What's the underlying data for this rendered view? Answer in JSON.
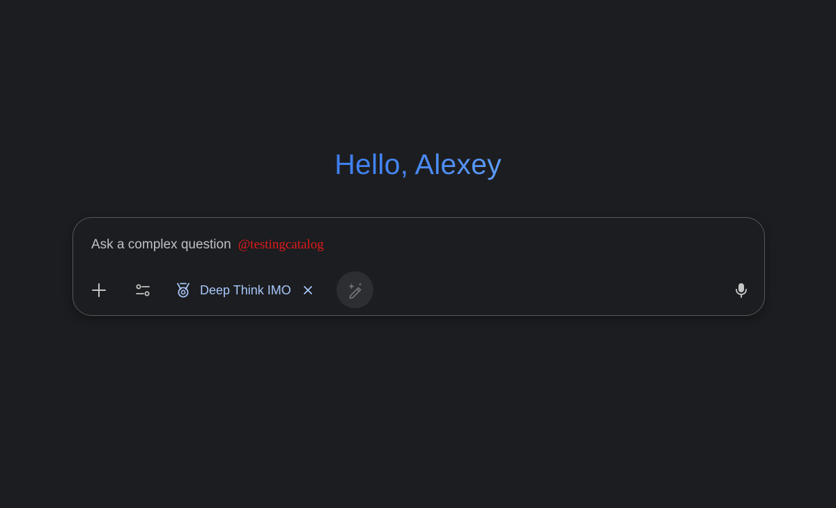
{
  "greeting": {
    "text": "Hello, Alexey",
    "gradient_colors": [
      "#3d7ef0",
      "#5d9bf7"
    ]
  },
  "composer": {
    "placeholder": "Ask a complex question",
    "watermark": "@testingcatalog",
    "watermark_color": "#e21b1b",
    "add_icon": "plus-icon",
    "tools_icon": "tune-sliders-icon",
    "mode_chip": {
      "icon": "medal-icon",
      "label": "Deep Think IMO",
      "close_icon": "close-icon",
      "color": "#a8c7fa"
    },
    "refine_icon": "magic-pencil-icon",
    "mic_icon": "microphone-icon"
  },
  "colors": {
    "background": "#1c1d20",
    "border": "#58595d",
    "text_secondary": "#bdc1c6",
    "icon": "#c4c7c5"
  }
}
